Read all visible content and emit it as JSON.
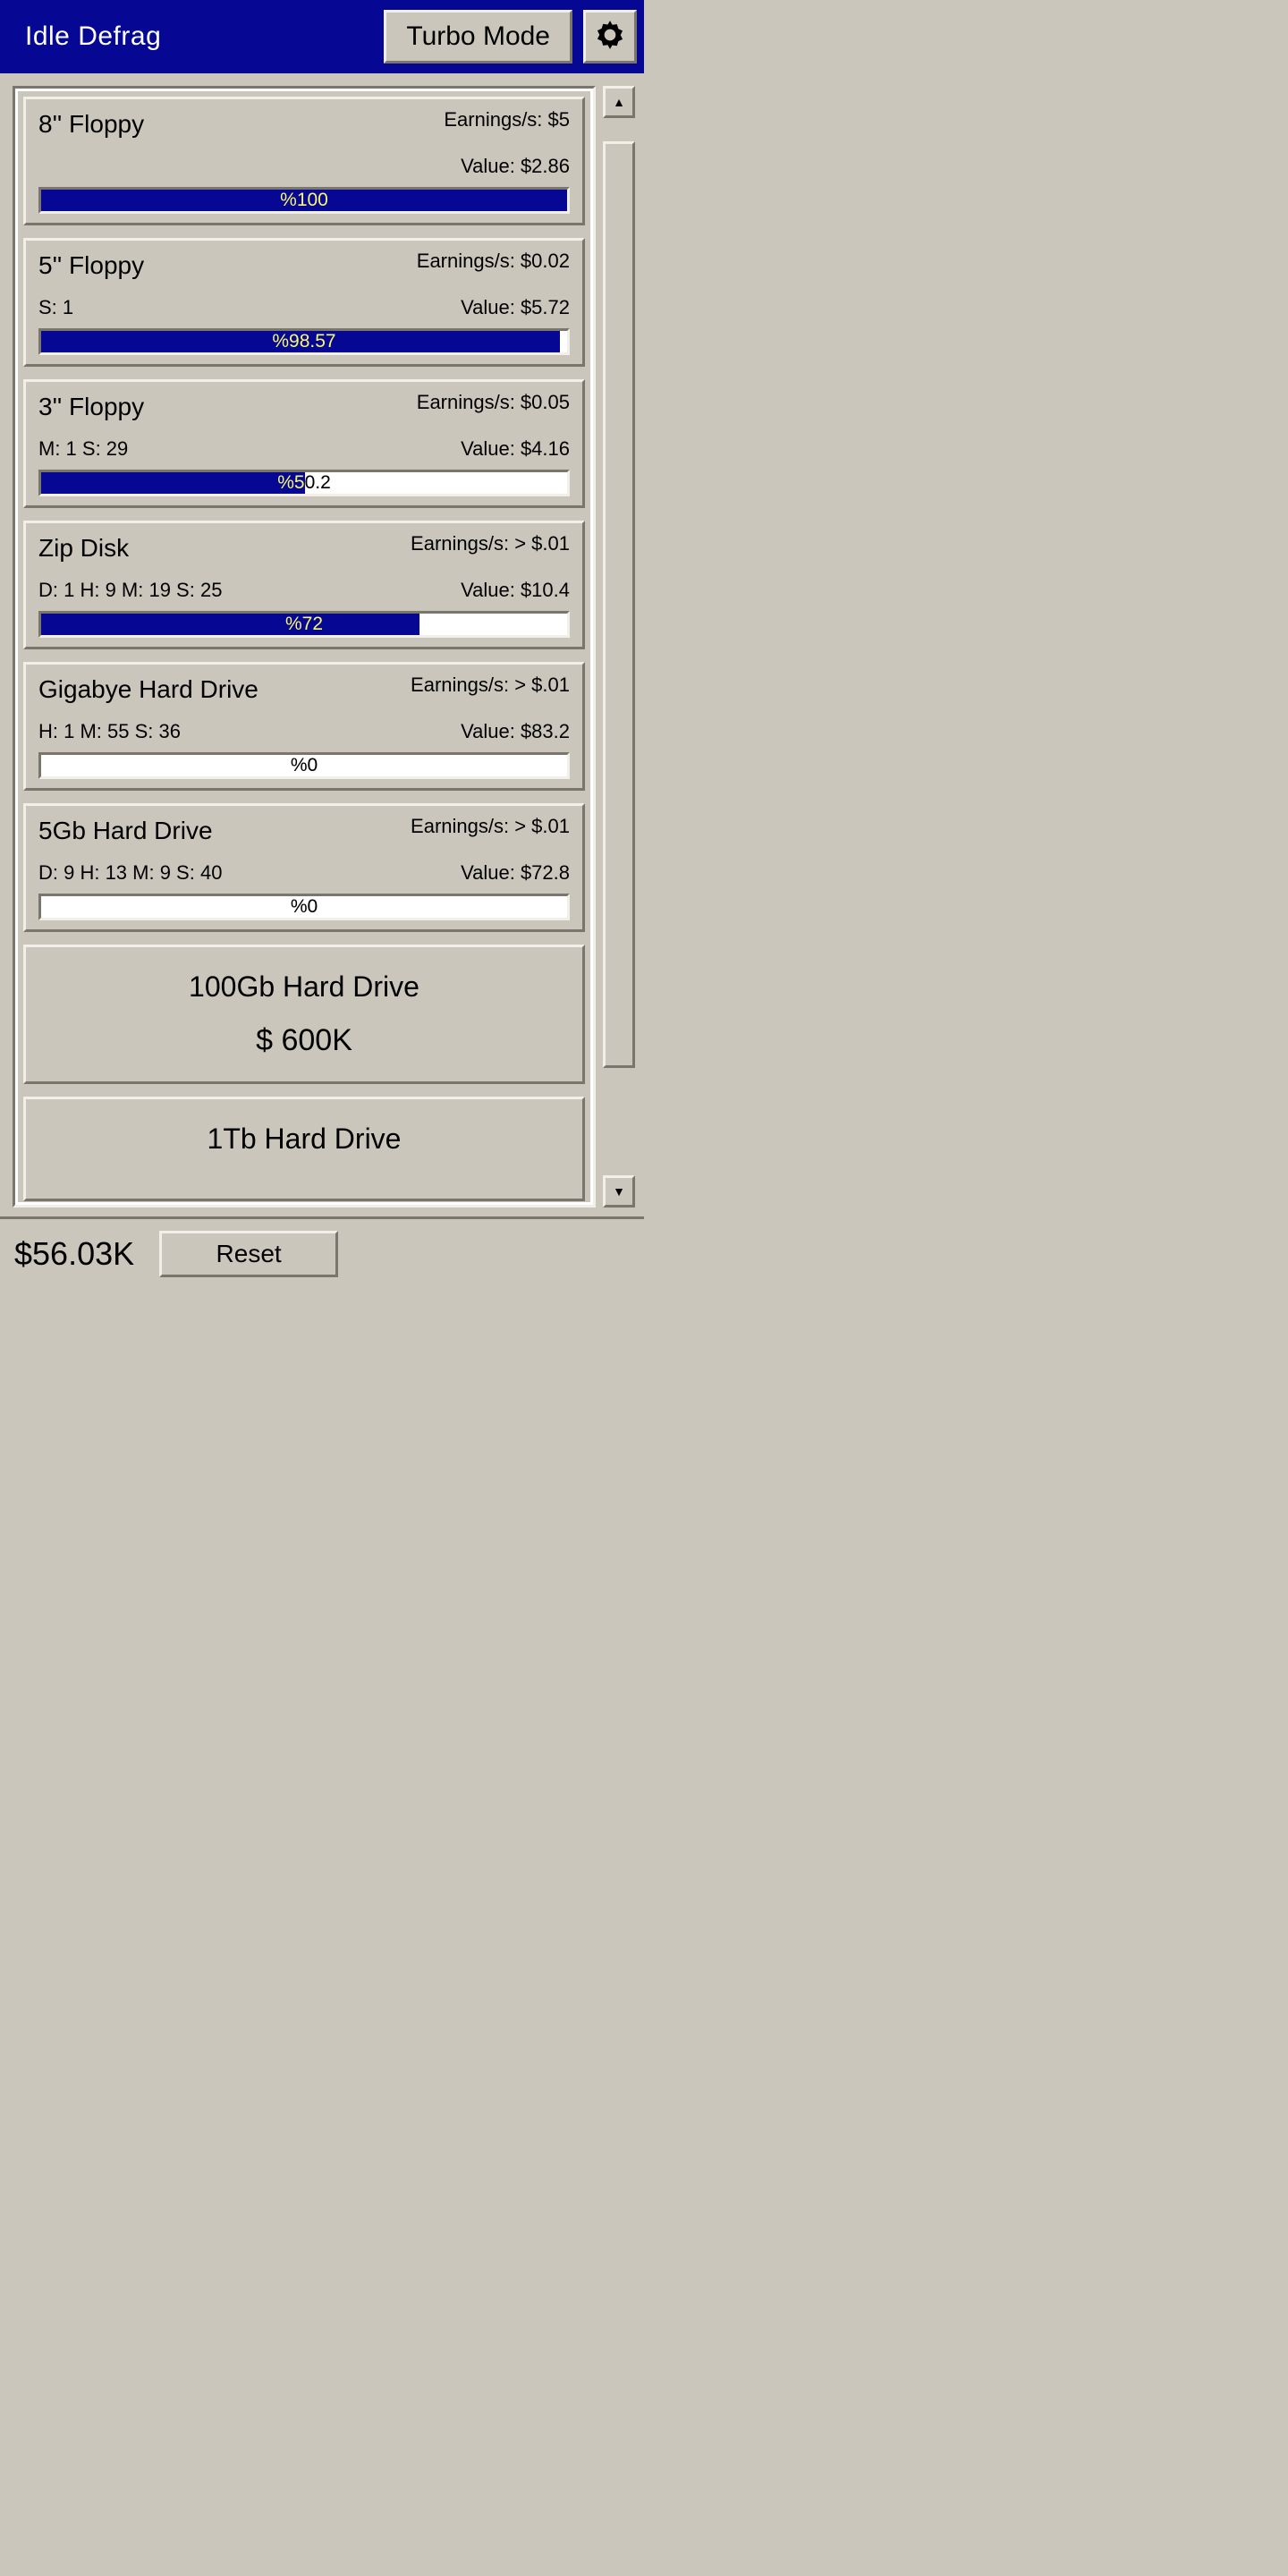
{
  "header": {
    "title": "Idle Defrag",
    "turbo_label": "Turbo Mode"
  },
  "drives": [
    {
      "name": "8'' Floppy",
      "earnings": "Earnings/s: $5",
      "value": "Value: $2.86",
      "timer": "",
      "percent": 100,
      "percent_label": "%100"
    },
    {
      "name": "5'' Floppy",
      "earnings": "Earnings/s: $0.02",
      "value": "Value: $5.72",
      "timer": "S: 1",
      "percent": 98.57,
      "percent_label": "%98.57"
    },
    {
      "name": "3'' Floppy",
      "earnings": "Earnings/s: $0.05",
      "value": "Value: $4.16",
      "timer": "M: 1 S: 29",
      "percent": 50.2,
      "percent_label": "%50.2"
    },
    {
      "name": "Zip Disk",
      "earnings": "Earnings/s: > $.01",
      "value": "Value: $10.4",
      "timer": "D: 1 H: 9 M: 19 S: 25",
      "percent": 72,
      "percent_label": "%72"
    },
    {
      "name": "Gigabye Hard Drive",
      "earnings": "Earnings/s: > $.01",
      "value": "Value: $83.2",
      "timer": "H: 1 M: 55 S: 36",
      "percent": 0,
      "percent_label": "%0"
    },
    {
      "name": "5Gb Hard Drive",
      "earnings": "Earnings/s: > $.01",
      "value": "Value: $72.8",
      "timer": "D: 9 H: 13 M: 9 S: 40",
      "percent": 0,
      "percent_label": "%0"
    }
  ],
  "locked": [
    {
      "name": "100Gb Hard Drive",
      "price": "$ 600K"
    },
    {
      "name": "1Tb Hard Drive",
      "price": ""
    }
  ],
  "scrollbar": {
    "thumb_top_pct": 2,
    "thumb_height_pct": 88
  },
  "footer": {
    "balance": "$56.03K",
    "reset_label": "Reset"
  }
}
